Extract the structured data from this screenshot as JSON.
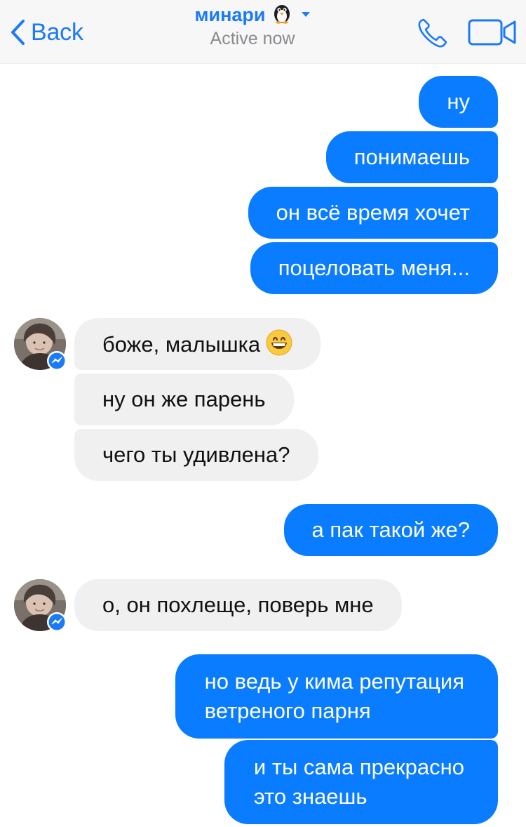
{
  "header": {
    "back_label": "Back",
    "contact_name": "минари",
    "contact_emoji": "penguin-emoji",
    "status": "Active now",
    "icons": {
      "back": "chevron-left-icon",
      "call": "phone-icon",
      "video": "video-camera-icon",
      "dropdown": "caret-down-icon"
    },
    "accent_color": "#1a7af8"
  },
  "messages": [
    {
      "sender": "me",
      "text": "ну"
    },
    {
      "sender": "me",
      "text": "понимаешь"
    },
    {
      "sender": "me",
      "text": "он всё время хочет"
    },
    {
      "sender": "me",
      "text": "поцеловать меня..."
    },
    {
      "sender": "contact",
      "text": "боже, малышка",
      "emoji": "grinning-face-emoji"
    },
    {
      "sender": "contact",
      "text": "ну он же парень"
    },
    {
      "sender": "contact",
      "text": "чего ты удивлена?"
    },
    {
      "sender": "me",
      "text": "а пак такой же?"
    },
    {
      "sender": "contact",
      "text": "о, он похлеще, поверь мне"
    },
    {
      "sender": "me",
      "lines": [
        "но ведь у кима репутация",
        "ветреного парня"
      ]
    },
    {
      "sender": "me",
      "lines": [
        "и ты сама прекрасно",
        "это знаешь"
      ]
    }
  ],
  "colors": {
    "outgoing_bubble": "#0a7cff",
    "incoming_bubble": "#f0f0f1",
    "messenger_badge": "#1a7af8"
  }
}
